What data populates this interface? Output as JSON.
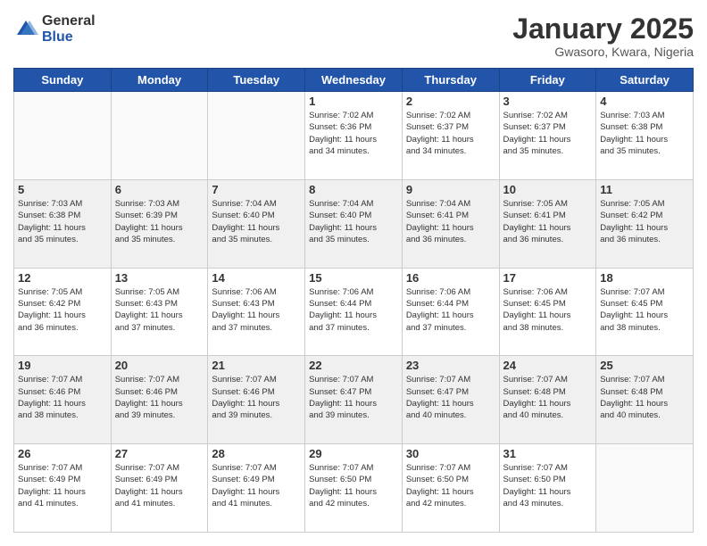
{
  "logo": {
    "general": "General",
    "blue": "Blue"
  },
  "header": {
    "title": "January 2025",
    "subtitle": "Gwasoro, Kwara, Nigeria"
  },
  "weekdays": [
    "Sunday",
    "Monday",
    "Tuesday",
    "Wednesday",
    "Thursday",
    "Friday",
    "Saturday"
  ],
  "weeks": [
    [
      {
        "day": "",
        "info": ""
      },
      {
        "day": "",
        "info": ""
      },
      {
        "day": "",
        "info": ""
      },
      {
        "day": "1",
        "info": "Sunrise: 7:02 AM\nSunset: 6:36 PM\nDaylight: 11 hours\nand 34 minutes."
      },
      {
        "day": "2",
        "info": "Sunrise: 7:02 AM\nSunset: 6:37 PM\nDaylight: 11 hours\nand 34 minutes."
      },
      {
        "day": "3",
        "info": "Sunrise: 7:02 AM\nSunset: 6:37 PM\nDaylight: 11 hours\nand 35 minutes."
      },
      {
        "day": "4",
        "info": "Sunrise: 7:03 AM\nSunset: 6:38 PM\nDaylight: 11 hours\nand 35 minutes."
      }
    ],
    [
      {
        "day": "5",
        "info": "Sunrise: 7:03 AM\nSunset: 6:38 PM\nDaylight: 11 hours\nand 35 minutes."
      },
      {
        "day": "6",
        "info": "Sunrise: 7:03 AM\nSunset: 6:39 PM\nDaylight: 11 hours\nand 35 minutes."
      },
      {
        "day": "7",
        "info": "Sunrise: 7:04 AM\nSunset: 6:40 PM\nDaylight: 11 hours\nand 35 minutes."
      },
      {
        "day": "8",
        "info": "Sunrise: 7:04 AM\nSunset: 6:40 PM\nDaylight: 11 hours\nand 35 minutes."
      },
      {
        "day": "9",
        "info": "Sunrise: 7:04 AM\nSunset: 6:41 PM\nDaylight: 11 hours\nand 36 minutes."
      },
      {
        "day": "10",
        "info": "Sunrise: 7:05 AM\nSunset: 6:41 PM\nDaylight: 11 hours\nand 36 minutes."
      },
      {
        "day": "11",
        "info": "Sunrise: 7:05 AM\nSunset: 6:42 PM\nDaylight: 11 hours\nand 36 minutes."
      }
    ],
    [
      {
        "day": "12",
        "info": "Sunrise: 7:05 AM\nSunset: 6:42 PM\nDaylight: 11 hours\nand 36 minutes."
      },
      {
        "day": "13",
        "info": "Sunrise: 7:05 AM\nSunset: 6:43 PM\nDaylight: 11 hours\nand 37 minutes."
      },
      {
        "day": "14",
        "info": "Sunrise: 7:06 AM\nSunset: 6:43 PM\nDaylight: 11 hours\nand 37 minutes."
      },
      {
        "day": "15",
        "info": "Sunrise: 7:06 AM\nSunset: 6:44 PM\nDaylight: 11 hours\nand 37 minutes."
      },
      {
        "day": "16",
        "info": "Sunrise: 7:06 AM\nSunset: 6:44 PM\nDaylight: 11 hours\nand 37 minutes."
      },
      {
        "day": "17",
        "info": "Sunrise: 7:06 AM\nSunset: 6:45 PM\nDaylight: 11 hours\nand 38 minutes."
      },
      {
        "day": "18",
        "info": "Sunrise: 7:07 AM\nSunset: 6:45 PM\nDaylight: 11 hours\nand 38 minutes."
      }
    ],
    [
      {
        "day": "19",
        "info": "Sunrise: 7:07 AM\nSunset: 6:46 PM\nDaylight: 11 hours\nand 38 minutes."
      },
      {
        "day": "20",
        "info": "Sunrise: 7:07 AM\nSunset: 6:46 PM\nDaylight: 11 hours\nand 39 minutes."
      },
      {
        "day": "21",
        "info": "Sunrise: 7:07 AM\nSunset: 6:46 PM\nDaylight: 11 hours\nand 39 minutes."
      },
      {
        "day": "22",
        "info": "Sunrise: 7:07 AM\nSunset: 6:47 PM\nDaylight: 11 hours\nand 39 minutes."
      },
      {
        "day": "23",
        "info": "Sunrise: 7:07 AM\nSunset: 6:47 PM\nDaylight: 11 hours\nand 40 minutes."
      },
      {
        "day": "24",
        "info": "Sunrise: 7:07 AM\nSunset: 6:48 PM\nDaylight: 11 hours\nand 40 minutes."
      },
      {
        "day": "25",
        "info": "Sunrise: 7:07 AM\nSunset: 6:48 PM\nDaylight: 11 hours\nand 40 minutes."
      }
    ],
    [
      {
        "day": "26",
        "info": "Sunrise: 7:07 AM\nSunset: 6:49 PM\nDaylight: 11 hours\nand 41 minutes."
      },
      {
        "day": "27",
        "info": "Sunrise: 7:07 AM\nSunset: 6:49 PM\nDaylight: 11 hours\nand 41 minutes."
      },
      {
        "day": "28",
        "info": "Sunrise: 7:07 AM\nSunset: 6:49 PM\nDaylight: 11 hours\nand 41 minutes."
      },
      {
        "day": "29",
        "info": "Sunrise: 7:07 AM\nSunset: 6:50 PM\nDaylight: 11 hours\nand 42 minutes."
      },
      {
        "day": "30",
        "info": "Sunrise: 7:07 AM\nSunset: 6:50 PM\nDaylight: 11 hours\nand 42 minutes."
      },
      {
        "day": "31",
        "info": "Sunrise: 7:07 AM\nSunset: 6:50 PM\nDaylight: 11 hours\nand 43 minutes."
      },
      {
        "day": "",
        "info": ""
      }
    ]
  ]
}
